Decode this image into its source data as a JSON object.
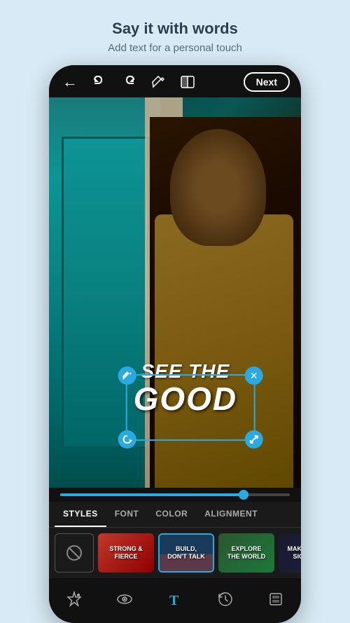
{
  "header": {
    "title": "Say it with words",
    "subtitle": "Add text for a personal touch"
  },
  "topbar": {
    "back_label": "←",
    "undo_label": "↩",
    "redo_label": "↪",
    "edit_label": "✏",
    "compare_label": "⊡",
    "next_label": "Next"
  },
  "text_overlay": {
    "line1": "SEE THE",
    "line2": "GOOD"
  },
  "styles_tabs": [
    {
      "id": "styles",
      "label": "STYLES",
      "active": true
    },
    {
      "id": "font",
      "label": "FONT",
      "active": false
    },
    {
      "id": "color",
      "label": "COLOR",
      "active": false
    },
    {
      "id": "alignment",
      "label": "ALIGNMENT",
      "active": false
    }
  ],
  "presets": [
    {
      "id": "none",
      "label": ""
    },
    {
      "id": "strong-fierce",
      "label": "STRONG & FIERCE",
      "bg": "red"
    },
    {
      "id": "build-dont-talk",
      "label": "BUILD, DON'T TALK",
      "bg": "blue",
      "active": true
    },
    {
      "id": "explore-world",
      "label": "EXPLORE THE WORLD",
      "bg": "green"
    },
    {
      "id": "make-it",
      "label": "MAKE IT SIG SIGNIFIC",
      "bg": "dark"
    }
  ],
  "bottom_toolbar": [
    {
      "id": "magic",
      "label": "✦",
      "active": false
    },
    {
      "id": "eye",
      "label": "👁",
      "active": false
    },
    {
      "id": "text",
      "label": "T",
      "active": true
    },
    {
      "id": "rotate",
      "label": "↺",
      "active": false
    },
    {
      "id": "layers",
      "label": "⊞",
      "active": false
    }
  ],
  "colors": {
    "accent": "#29abe2",
    "bg": "#d8eaf5",
    "phone_bg": "#1a1a1a"
  }
}
